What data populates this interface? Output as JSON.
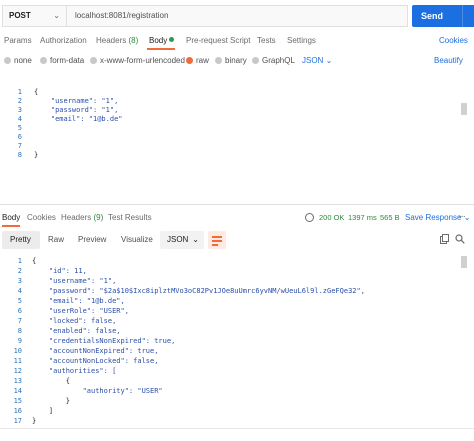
{
  "request": {
    "method": "POST",
    "url": "localhost:8081/registration",
    "send_label": "Send"
  },
  "request_tabs": [
    {
      "label": "Params"
    },
    {
      "label": "Authorization"
    },
    {
      "label": "Headers",
      "count": "(8)"
    },
    {
      "label": "Body"
    },
    {
      "label": "Pre-request Script"
    },
    {
      "label": "Tests"
    },
    {
      "label": "Settings"
    }
  ],
  "cookies_label": "Cookies",
  "body_types": [
    "none",
    "form-data",
    "x-www-form-urlencoded",
    "raw",
    "binary",
    "GraphQL"
  ],
  "body_type_selected": "raw",
  "body_format": "JSON",
  "beautify_label": "Beautify",
  "request_body_lines": [
    {
      "n": "1",
      "text": "{"
    },
    {
      "n": "2",
      "text": "    \"username\": \"1\","
    },
    {
      "n": "3",
      "text": "    \"password\": \"1\","
    },
    {
      "n": "4",
      "text": "    \"email\": \"1@b.de\""
    },
    {
      "n": "5",
      "text": ""
    },
    {
      "n": "6",
      "text": ""
    },
    {
      "n": "7",
      "text": ""
    },
    {
      "n": "8",
      "text": "}"
    }
  ],
  "response_tabs": [
    {
      "label": "Body"
    },
    {
      "label": "Cookies"
    },
    {
      "label": "Headers",
      "count": "(9)"
    },
    {
      "label": "Test Results"
    }
  ],
  "response_status": {
    "code": "200 OK",
    "time": "1397 ms",
    "size": "565 B"
  },
  "save_response_label": "Save Response",
  "view_modes": [
    "Pretty",
    "Raw",
    "Preview",
    "Visualize"
  ],
  "view_mode_selected": "Pretty",
  "response_format": "JSON",
  "response_body_lines": [
    {
      "n": "1",
      "text": "{"
    },
    {
      "n": "2",
      "text": "    \"id\": 11,"
    },
    {
      "n": "3",
      "text": "    \"username\": \"1\","
    },
    {
      "n": "4",
      "text": "    \"password\": \"$2a$10$Ixc8iplztMVo3oC82Pv1JOe8uUmrc6yvNM/wUeuL6l9l.zGeFQe32\","
    },
    {
      "n": "5",
      "text": "    \"email\": \"1@b.de\","
    },
    {
      "n": "6",
      "text": "    \"userRole\": \"USER\","
    },
    {
      "n": "7",
      "text": "    \"locked\": false,"
    },
    {
      "n": "8",
      "text": "    \"enabled\": false,"
    },
    {
      "n": "9",
      "text": "    \"credentialsNonExpired\": true,"
    },
    {
      "n": "10",
      "text": "    \"accountNonExpired\": true,"
    },
    {
      "n": "11",
      "text": "    \"accountNonLocked\": false,"
    },
    {
      "n": "12",
      "text": "    \"authorities\": ["
    },
    {
      "n": "13",
      "text": "        {"
    },
    {
      "n": "14",
      "text": "            \"authority\": \"USER\""
    },
    {
      "n": "15",
      "text": "        }"
    },
    {
      "n": "16",
      "text": "    ]"
    },
    {
      "n": "17",
      "text": "}"
    }
  ],
  "colors": {
    "send_button": "#1c6fe0",
    "active_tab_underline": "#f26b3a",
    "status_ok": "#2d8a3e",
    "json_key": "#2a4fa8",
    "json_string": "#1e5faa"
  }
}
